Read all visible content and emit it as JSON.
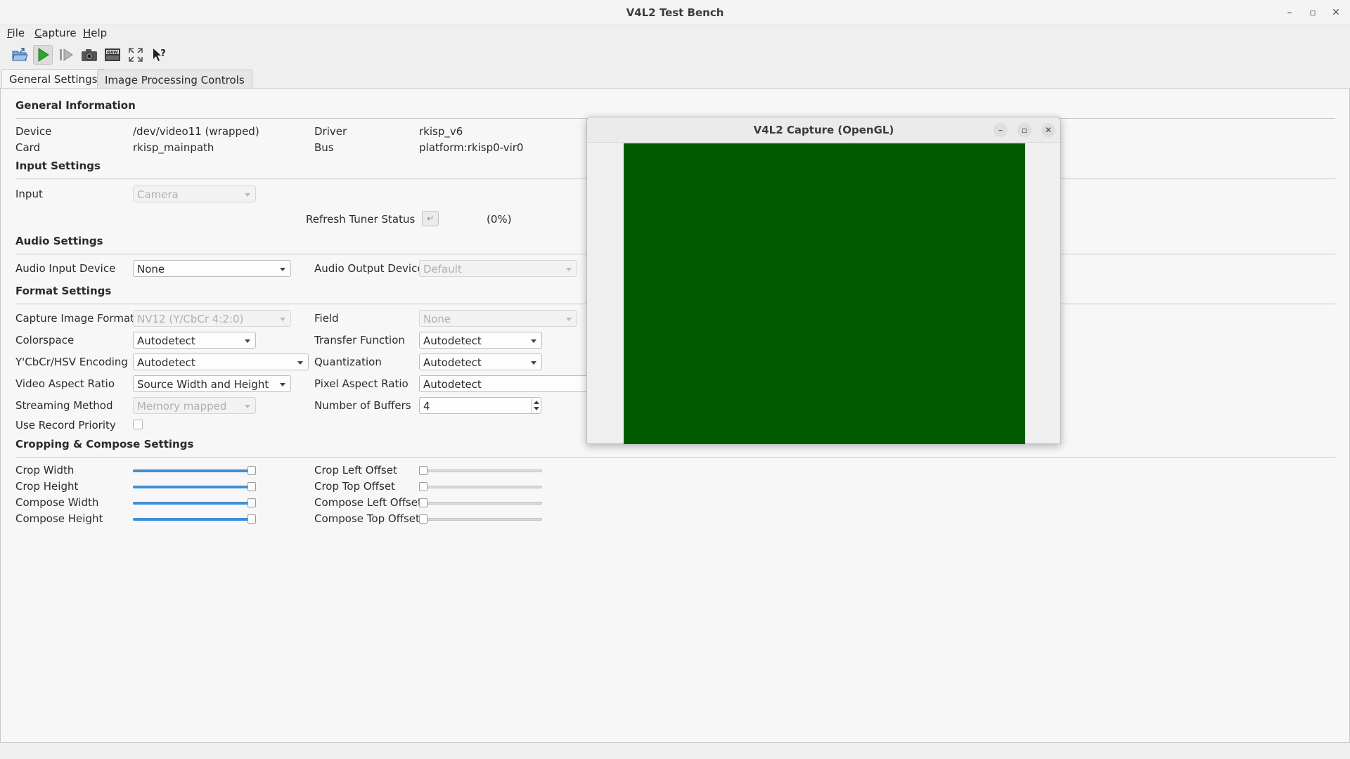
{
  "window": {
    "title": "V4L2 Test Bench"
  },
  "menu": [
    {
      "label": "File",
      "u": "F",
      "rest": "ile"
    },
    {
      "label": "Capture",
      "u": "C",
      "rest": "apture"
    },
    {
      "label": "Help",
      "u": "H",
      "rest": "elp"
    }
  ],
  "toolbar_icons": [
    "open-icon",
    "start-capture-icon",
    "step-icon",
    "snapshot-icon",
    "raw-icon",
    "fullscreen-icon",
    "whats-this-icon"
  ],
  "tabs": {
    "general": "General Settings",
    "imageproc": "Image Processing Controls"
  },
  "sections": {
    "general_info": "General Information",
    "input": "Input Settings",
    "audio": "Audio Settings",
    "format": "Format Settings",
    "crop": "Cropping & Compose Settings"
  },
  "general_info": {
    "device_label": "Device",
    "device_value": "/dev/video11 (wrapped)",
    "driver_label": "Driver",
    "driver_value": "rkisp_v6",
    "card_label": "Card",
    "card_value": "rkisp_mainpath",
    "bus_label": "Bus",
    "bus_value": "platform:rkisp0-vir0"
  },
  "input": {
    "input_label": "Input",
    "input_value": "Camera",
    "refresh_label": "Refresh Tuner Status",
    "refresh_button": "↵",
    "tuner_status": "(0%)"
  },
  "audio": {
    "in_label": "Audio Input Device",
    "in_value": "None",
    "out_label": "Audio Output Device",
    "out_value": "Default"
  },
  "format": {
    "capfmt_label": "Capture Image Formats",
    "capfmt_value": "NV12 (Y/CbCr 4:2:0)",
    "field_label": "Field",
    "field_value": "None",
    "colorspace_label": "Colorspace",
    "colorspace_value": "Autodetect",
    "transfer_label": "Transfer Function",
    "transfer_value": "Autodetect",
    "encoding_label": "Y'CbCr/HSV Encoding",
    "encoding_value": "Autodetect",
    "quant_label": "Quantization",
    "quant_value": "Autodetect",
    "aspect_label": "Video Aspect Ratio",
    "aspect_value": "Source Width and Height",
    "pixaspect_label": "Pixel Aspect Ratio",
    "pixaspect_value": "Autodetect",
    "streaming_label": "Streaming Method",
    "streaming_value": "Memory mapped I/O",
    "buffers_label": "Number of Buffers",
    "buffers_value": "4",
    "priority_label": "Use Record Priority",
    "priority_checked": false
  },
  "crop": {
    "crop_width": "Crop Width",
    "crop_height": "Crop Height",
    "compose_width": "Compose Width",
    "compose_height": "Compose Height",
    "crop_left": "Crop Left Offset",
    "crop_top": "Crop Top Offset",
    "compose_left": "Compose Left Offset",
    "compose_top": "Compose Top Offset",
    "levels": {
      "crop_width": 1.0,
      "crop_height": 1.0,
      "compose_width": 1.0,
      "compose_height": 1.0,
      "crop_left": 0.0,
      "crop_top": 0.0,
      "compose_left": 0.0,
      "compose_top": 0.0
    }
  },
  "capture_window": {
    "title": "V4L2 Capture (OpenGL)",
    "video_color": "#005a00"
  },
  "colors": {
    "accent": "#3d8fd6",
    "play_green": "#2fa52f"
  }
}
